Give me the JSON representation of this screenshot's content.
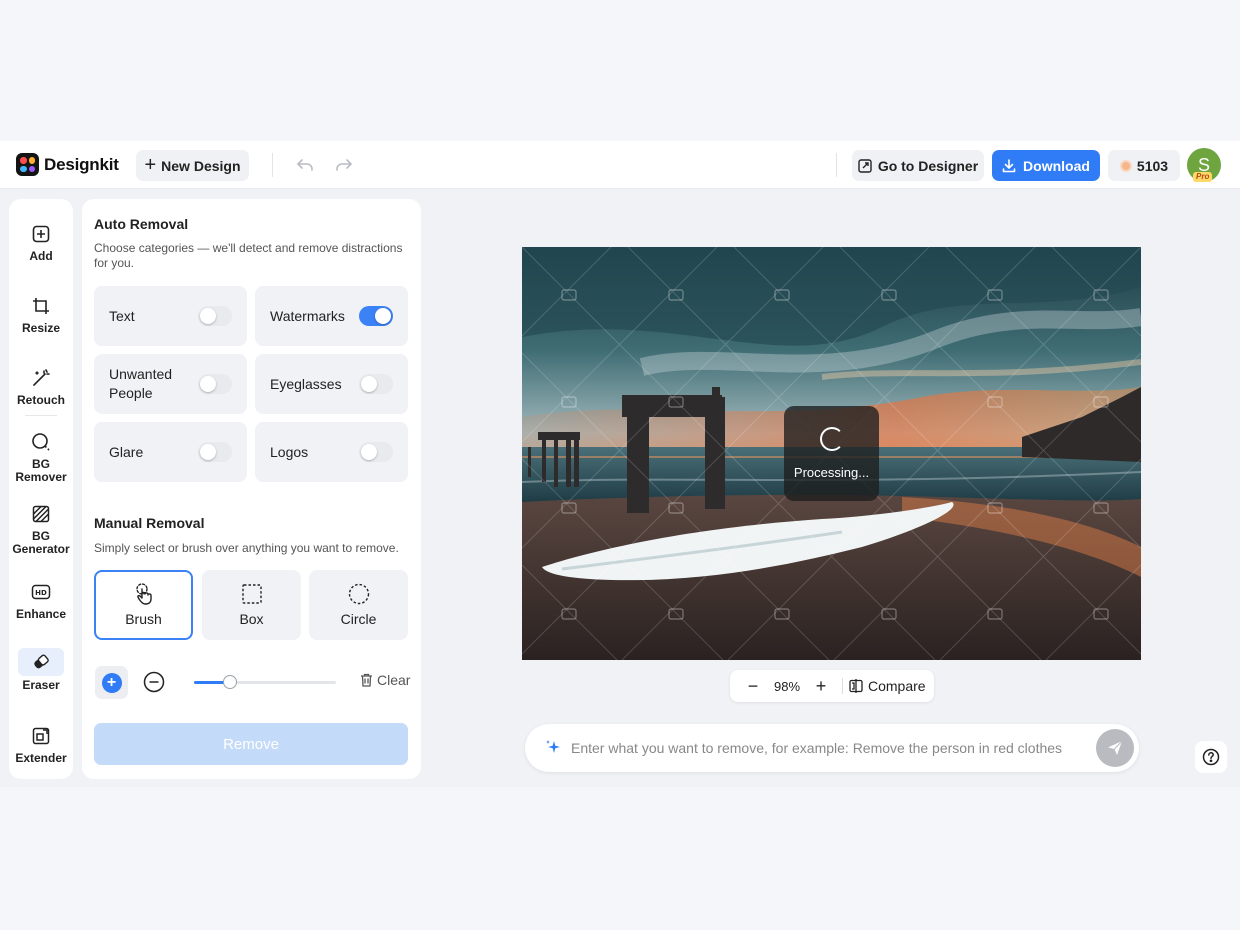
{
  "topbar": {
    "brand": "Designkit",
    "new_design_label": "New Design",
    "go_to_designer_label": "Go to Designer",
    "download_label": "Download",
    "credits": "5103",
    "avatar_initial": "S",
    "pro_badge": "Pro",
    "accent_color": "#2f7cf6"
  },
  "tools": [
    {
      "label": "Add",
      "icon": "add-square-icon"
    },
    {
      "label": "Resize",
      "icon": "crop-icon"
    },
    {
      "label": "Retouch",
      "icon": "magic-wand-icon"
    },
    {
      "label": "BG Remover",
      "icon": "bg-remover-icon"
    },
    {
      "label": "BG Generator",
      "icon": "bg-generator-icon"
    },
    {
      "label": "Enhance",
      "icon": "hd-icon"
    },
    {
      "label": "Eraser",
      "icon": "eraser-icon",
      "active": true
    },
    {
      "label": "Extender",
      "icon": "extender-icon"
    }
  ],
  "auto_removal": {
    "title": "Auto Removal",
    "description": "Choose categories — we'll detect and remove distractions for you.",
    "categories": [
      {
        "label": "Text",
        "on": false
      },
      {
        "label": "Watermarks",
        "on": true
      },
      {
        "label": "Unwanted People",
        "on": false
      },
      {
        "label": "Eyeglasses",
        "on": false
      },
      {
        "label": "Glare",
        "on": false
      },
      {
        "label": "Logos",
        "on": false
      }
    ]
  },
  "manual_removal": {
    "title": "Manual Removal",
    "description": "Simply select or brush over anything you want to remove.",
    "modes": [
      {
        "label": "Brush",
        "selected": true
      },
      {
        "label": "Box",
        "selected": false
      },
      {
        "label": "Circle",
        "selected": false
      }
    ],
    "brush_size": 0.25,
    "clear_label": "Clear",
    "remove_label": "Remove"
  },
  "canvas": {
    "processing_label": "Processing...",
    "zoom": "98%",
    "compare_label": "Compare"
  },
  "prompt": {
    "placeholder": "Enter what you want to remove, for example: Remove the person in red clothes"
  }
}
